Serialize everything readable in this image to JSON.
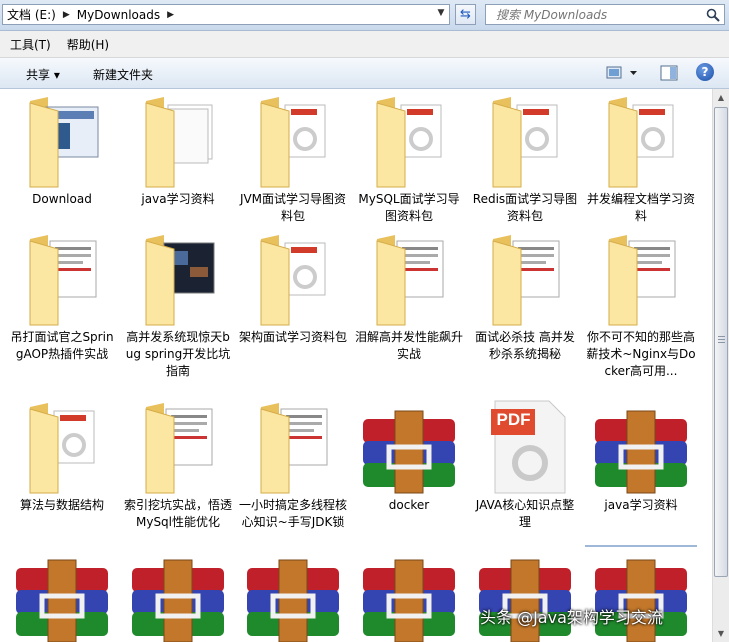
{
  "address": {
    "crumbs": [
      "文档 (E:)",
      "MyDownloads"
    ],
    "search_placeholder": "搜索 MyDownloads"
  },
  "menubar": {
    "items": [
      "工具(T)",
      "帮助(H)"
    ]
  },
  "cmdbar": {
    "share": "共享 ▾",
    "new_folder": "新建文件夹"
  },
  "files": [
    {
      "label": "Download",
      "kind": "folder-app"
    },
    {
      "label": "java学习资料",
      "kind": "folder-paper"
    },
    {
      "label": "JVM面试学习导图资料包",
      "kind": "folder-pdf"
    },
    {
      "label": "MySQL面试学习导图资料包",
      "kind": "folder-pdf"
    },
    {
      "label": "Redis面试学习导图资料包",
      "kind": "folder-pdf"
    },
    {
      "label": "并发编程文档学习资料",
      "kind": "folder-pdf"
    },
    {
      "label": "吊打面试官之SpringAOP热插件实战",
      "kind": "folder-doc"
    },
    {
      "label": "高并发系统现惊天bug spring开发比坑指南",
      "kind": "folder-video"
    },
    {
      "label": "架构面试学习资料包",
      "kind": "folder-pdf"
    },
    {
      "label": "泪解高并发性能飙升实战",
      "kind": "folder-doc"
    },
    {
      "label": "面试必杀技 高并发秒杀系统揭秘",
      "kind": "folder-doc"
    },
    {
      "label": "你不可不知的那些高薪技术~Nginx与Docker高可用...",
      "kind": "folder-doc"
    },
    {
      "label": "算法与数据结构",
      "kind": "folder-pdf"
    },
    {
      "label": "索引挖坑实战，悟透MySql性能优化",
      "kind": "folder-doc"
    },
    {
      "label": "一小时搞定多线程核心知识~手写JDK锁",
      "kind": "folder-doc"
    },
    {
      "label": "docker",
      "kind": "rar"
    },
    {
      "label": "JAVA核心知识点整理",
      "kind": "pdf"
    },
    {
      "label": "java学习资料",
      "kind": "rar"
    },
    {
      "label": "",
      "kind": "rar"
    },
    {
      "label": "",
      "kind": "rar"
    },
    {
      "label": "",
      "kind": "rar"
    },
    {
      "label": "",
      "kind": "rar"
    },
    {
      "label": "",
      "kind": "rar"
    },
    {
      "label": "",
      "kind": "rar"
    }
  ],
  "pdf_badge": "PDF",
  "watermark": "头条 @Java架构学习交流",
  "colors": {
    "folder_light": "#fbe7a1",
    "folder_dark": "#e9c15c",
    "rar_red": "#c0202a",
    "rar_blue": "#3444b0",
    "rar_green": "#1f8a2c",
    "rar_strap": "#c2772a"
  }
}
